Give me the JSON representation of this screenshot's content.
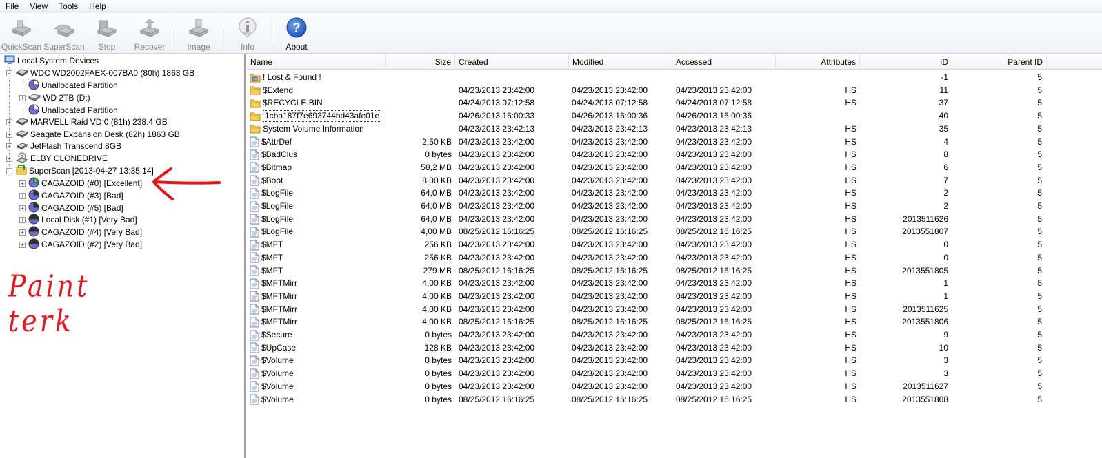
{
  "menu": [
    "File",
    "View",
    "Tools",
    "Help"
  ],
  "toolbar": {
    "buttons": [
      {
        "label": "QuickScan",
        "icon": "drive-scan-icon",
        "enabled": false
      },
      {
        "label": "SuperScan",
        "icon": "drives-scan-icon",
        "enabled": false
      },
      {
        "label": "Stop",
        "icon": "stop-drive-icon",
        "enabled": false
      },
      {
        "label": "Recover",
        "icon": "recover-drive-icon",
        "enabled": false
      },
      {
        "label": "Image",
        "icon": "image-drive-icon",
        "enabled": false
      },
      {
        "label": "Info",
        "icon": "info-icon",
        "enabled": false
      },
      {
        "label": "About",
        "icon": "help-icon",
        "enabled": true
      }
    ]
  },
  "tree": {
    "root": "Local System Devices",
    "nodes": [
      {
        "label": "WDC WD2002FAEX-007BA0 (80h) 1863  GB",
        "icon": "hard-drive-icon"
      },
      {
        "label": "Unallocated Partition",
        "icon": "partition-icon"
      },
      {
        "label": "WD 2TB (D:)",
        "icon": "volume-icon"
      },
      {
        "label": "Unallocated Partition",
        "icon": "partition-icon"
      },
      {
        "label": "MARVELL Raid VD 0 (81h) 238.4 GB",
        "icon": "hard-drive-icon"
      },
      {
        "label": "Seagate Expansion Desk (82h) 1863  GB",
        "icon": "hard-drive-icon"
      },
      {
        "label": "JetFlash Transcend 8GB",
        "icon": "usb-drive-icon"
      },
      {
        "label": "ELBY CLONEDRIVE",
        "icon": "cd-drive-icon"
      },
      {
        "label": "SuperScan [2013-04-27 13:35:14]",
        "icon": "superscan-folder-icon"
      },
      {
        "label": "CAGAZOID (#0) [Excellent]",
        "icon": "partition-excellent-icon"
      },
      {
        "label": "CAGAZOID (#3) [Bad]",
        "icon": "partition-bad-icon"
      },
      {
        "label": "CAGAZOID (#5) [Bad]",
        "icon": "partition-bad-icon"
      },
      {
        "label": "Local Disk (#1) [Very Bad]",
        "icon": "partition-verybad-icon"
      },
      {
        "label": "CAGAZOID (#4) [Very Bad]",
        "icon": "partition-verybad-icon"
      },
      {
        "label": "CAGAZOID (#2) [Very Bad]",
        "icon": "partition-verybad-icon"
      }
    ]
  },
  "table": {
    "columns": [
      "Name",
      "Size",
      "Created",
      "Modified",
      "Accessed",
      "Attributes",
      "ID",
      "Parent ID"
    ],
    "rows": [
      {
        "icon": "lostfound-folder-icon",
        "name": "! Lost & Found !",
        "size": "",
        "created": "",
        "modified": "",
        "accessed": "",
        "attr": "",
        "id": "-1",
        "parent": "5"
      },
      {
        "icon": "folder-icon",
        "name": "$Extend",
        "size": "",
        "created": "04/23/2013 23:42:00",
        "modified": "04/23/2013 23:42:00",
        "accessed": "04/23/2013 23:42:00",
        "attr": "HS",
        "id": "11",
        "parent": "5"
      },
      {
        "icon": "folder-icon",
        "name": "$RECYCLE.BIN",
        "size": "",
        "created": "04/24/2013 07:12:58",
        "modified": "04/24/2013 07:12:58",
        "accessed": "04/24/2013 07:12:58",
        "attr": "HS",
        "id": "37",
        "parent": "5"
      },
      {
        "icon": "folder-icon",
        "name": "1cba187f7e693744bd43afe01e",
        "size": "",
        "created": "04/26/2013 16:00:33",
        "modified": "04/26/2013 16:00:36",
        "accessed": "04/26/2013 16:00:36",
        "attr": "",
        "id": "40",
        "parent": "5",
        "selected": true
      },
      {
        "icon": "folder-icon",
        "name": "System Volume Information",
        "size": "",
        "created": "04/23/2013 23:42:13",
        "modified": "04/23/2013 23:42:13",
        "accessed": "04/23/2013 23:42:13",
        "attr": "HS",
        "id": "35",
        "parent": "5"
      },
      {
        "icon": "file-icon",
        "name": "$AttrDef",
        "size": "2,50 KB",
        "created": "04/23/2013 23:42:00",
        "modified": "04/23/2013 23:42:00",
        "accessed": "04/23/2013 23:42:00",
        "attr": "HS",
        "id": "4",
        "parent": "5"
      },
      {
        "icon": "file-icon",
        "name": "$BadClus",
        "size": "0 bytes",
        "created": "04/23/2013 23:42:00",
        "modified": "04/23/2013 23:42:00",
        "accessed": "04/23/2013 23:42:00",
        "attr": "HS",
        "id": "8",
        "parent": "5"
      },
      {
        "icon": "file-icon",
        "name": "$Bitmap",
        "size": "58,2 MB",
        "created": "04/23/2013 23:42:00",
        "modified": "04/23/2013 23:42:00",
        "accessed": "04/23/2013 23:42:00",
        "attr": "HS",
        "id": "6",
        "parent": "5"
      },
      {
        "icon": "file-icon",
        "name": "$Boot",
        "size": "8,00 KB",
        "created": "04/23/2013 23:42:00",
        "modified": "04/23/2013 23:42:00",
        "accessed": "04/23/2013 23:42:00",
        "attr": "HS",
        "id": "7",
        "parent": "5"
      },
      {
        "icon": "file-icon",
        "name": "$LogFile",
        "size": "64,0 MB",
        "created": "04/23/2013 23:42:00",
        "modified": "04/23/2013 23:42:00",
        "accessed": "04/23/2013 23:42:00",
        "attr": "HS",
        "id": "2",
        "parent": "5"
      },
      {
        "icon": "file-icon",
        "name": "$LogFile",
        "size": "64,0 MB",
        "created": "04/23/2013 23:42:00",
        "modified": "04/23/2013 23:42:00",
        "accessed": "04/23/2013 23:42:00",
        "attr": "HS",
        "id": "2",
        "parent": "5"
      },
      {
        "icon": "file-icon",
        "name": "$LogFile",
        "size": "64,0 MB",
        "created": "04/23/2013 23:42:00",
        "modified": "04/23/2013 23:42:00",
        "accessed": "04/23/2013 23:42:00",
        "attr": "HS",
        "id": "2013511626",
        "parent": "5"
      },
      {
        "icon": "file-icon",
        "name": "$LogFile",
        "size": "4,00 MB",
        "created": "08/25/2012 16:16:25",
        "modified": "08/25/2012 16:16:25",
        "accessed": "08/25/2012 16:16:25",
        "attr": "HS",
        "id": "2013551807",
        "parent": "5"
      },
      {
        "icon": "file-icon",
        "name": "$MFT",
        "size": "256 KB",
        "created": "04/23/2013 23:42:00",
        "modified": "04/23/2013 23:42:00",
        "accessed": "04/23/2013 23:42:00",
        "attr": "HS",
        "id": "0",
        "parent": "5"
      },
      {
        "icon": "file-icon",
        "name": "$MFT",
        "size": "256 KB",
        "created": "04/23/2013 23:42:00",
        "modified": "04/23/2013 23:42:00",
        "accessed": "04/23/2013 23:42:00",
        "attr": "HS",
        "id": "0",
        "parent": "5"
      },
      {
        "icon": "file-icon",
        "name": "$MFT",
        "size": "279 MB",
        "created": "08/25/2012 16:16:25",
        "modified": "08/25/2012 16:16:25",
        "accessed": "08/25/2012 16:16:25",
        "attr": "HS",
        "id": "2013551805",
        "parent": "5"
      },
      {
        "icon": "file-icon",
        "name": "$MFTMirr",
        "size": "4,00 KB",
        "created": "04/23/2013 23:42:00",
        "modified": "04/23/2013 23:42:00",
        "accessed": "04/23/2013 23:42:00",
        "attr": "HS",
        "id": "1",
        "parent": "5"
      },
      {
        "icon": "file-icon",
        "name": "$MFTMirr",
        "size": "4,00 KB",
        "created": "04/23/2013 23:42:00",
        "modified": "04/23/2013 23:42:00",
        "accessed": "04/23/2013 23:42:00",
        "attr": "HS",
        "id": "1",
        "parent": "5"
      },
      {
        "icon": "file-icon",
        "name": "$MFTMirr",
        "size": "4,00 KB",
        "created": "04/23/2013 23:42:00",
        "modified": "04/23/2013 23:42:00",
        "accessed": "04/23/2013 23:42:00",
        "attr": "HS",
        "id": "2013511625",
        "parent": "5"
      },
      {
        "icon": "file-icon",
        "name": "$MFTMirr",
        "size": "4,00 KB",
        "created": "08/25/2012 16:16:25",
        "modified": "08/25/2012 16:16:25",
        "accessed": "08/25/2012 16:16:25",
        "attr": "HS",
        "id": "2013551806",
        "parent": "5"
      },
      {
        "icon": "file-icon",
        "name": "$Secure",
        "size": "0 bytes",
        "created": "04/23/2013 23:42:00",
        "modified": "04/23/2013 23:42:00",
        "accessed": "04/23/2013 23:42:00",
        "attr": "HS",
        "id": "9",
        "parent": "5"
      },
      {
        "icon": "file-icon",
        "name": "$UpCase",
        "size": "128 KB",
        "created": "04/23/2013 23:42:00",
        "modified": "04/23/2013 23:42:00",
        "accessed": "04/23/2013 23:42:00",
        "attr": "HS",
        "id": "10",
        "parent": "5"
      },
      {
        "icon": "file-icon",
        "name": "$Volume",
        "size": "0 bytes",
        "created": "04/23/2013 23:42:00",
        "modified": "04/23/2013 23:42:00",
        "accessed": "04/23/2013 23:42:00",
        "attr": "HS",
        "id": "3",
        "parent": "5"
      },
      {
        "icon": "file-icon",
        "name": "$Volume",
        "size": "0 bytes",
        "created": "04/23/2013 23:42:00",
        "modified": "04/23/2013 23:42:00",
        "accessed": "04/23/2013 23:42:00",
        "attr": "HS",
        "id": "3",
        "parent": "5"
      },
      {
        "icon": "file-icon",
        "name": "$Volume",
        "size": "0 bytes",
        "created": "04/23/2013 23:42:00",
        "modified": "04/23/2013 23:42:00",
        "accessed": "04/23/2013 23:42:00",
        "attr": "HS",
        "id": "2013511627",
        "parent": "5"
      },
      {
        "icon": "file-icon",
        "name": "$Volume",
        "size": "0 bytes",
        "created": "08/25/2012 16:16:25",
        "modified": "08/25/2012 16:16:25",
        "accessed": "08/25/2012 16:16:25",
        "attr": "HS",
        "id": "2013551808",
        "parent": "5"
      }
    ]
  },
  "annotation": {
    "arrow_color": "#e8141c",
    "handwritten_text": "Paint terk",
    "handwritten_color": "#e8141c"
  }
}
